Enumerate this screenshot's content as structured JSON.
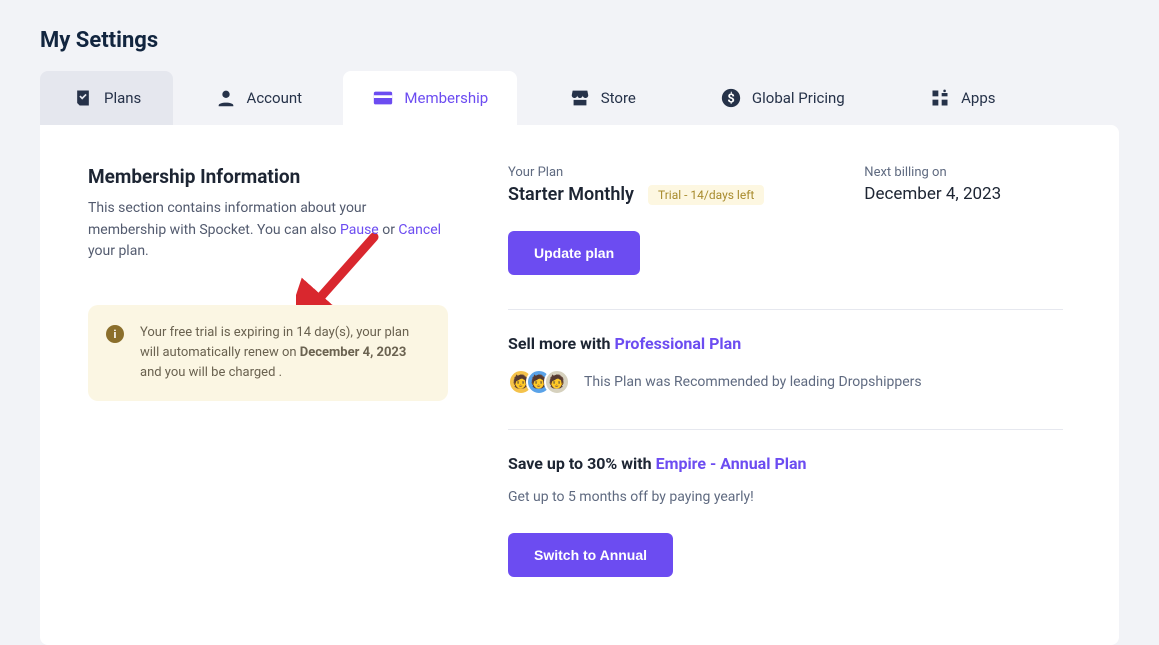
{
  "page_title": "My Settings",
  "tabs": [
    {
      "label": "Plans"
    },
    {
      "label": "Account"
    },
    {
      "label": "Membership"
    },
    {
      "label": "Store"
    },
    {
      "label": "Global Pricing"
    },
    {
      "label": "Apps"
    }
  ],
  "left": {
    "heading": "Membership Information",
    "body_a": "This section contains information about your membership with Spocket. You can also ",
    "pause": "Pause",
    "or": " or ",
    "cancel": "Cancel",
    "body_b": " your plan.",
    "notice_a": "Your free trial is expiring in 14 day(s), your plan will automatically renew on ",
    "notice_date": "December 4, 2023",
    "notice_b": " and you will be charged .",
    "info_glyph": "i"
  },
  "right": {
    "your_plan_label": "Your Plan",
    "plan_name": "Starter Monthly",
    "trial_badge": "Trial - 14/days left",
    "next_billing_label": "Next billing on",
    "next_billing_date": "December 4, 2023",
    "update_btn": "Update plan",
    "promo1_prefix": "Sell more with ",
    "promo1_plan": "Professional Plan",
    "promo1_rec": "This Plan was Recommended by leading Dropshippers",
    "promo2_prefix": "Save up to 30% with ",
    "promo2_plan": "Empire - Annual Plan",
    "promo2_sub": "Get up to 5 months off by paying yearly!",
    "switch_btn": "Switch to Annual"
  }
}
